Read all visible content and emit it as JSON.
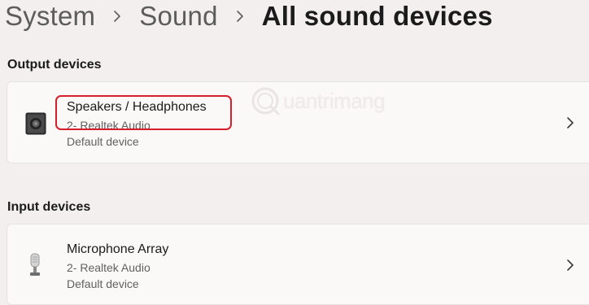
{
  "breadcrumb": {
    "items": [
      "System",
      "Sound",
      "All sound devices"
    ]
  },
  "sections": {
    "output": {
      "title": "Output devices",
      "device": {
        "name": "Speakers / Headphones",
        "sub1": "2- Realtek Audio",
        "sub2": "Default device",
        "icon": "speaker-icon"
      }
    },
    "input": {
      "title": "Input devices",
      "device": {
        "name": "Microphone Array",
        "sub1": "2- Realtek Audio",
        "sub2": "Default device",
        "icon": "microphone-icon"
      }
    }
  },
  "watermark": {
    "text": "uantrimang"
  },
  "colors": {
    "highlight": "#d51f2a",
    "background": "#f3efef",
    "card": "#fbf8f8"
  }
}
